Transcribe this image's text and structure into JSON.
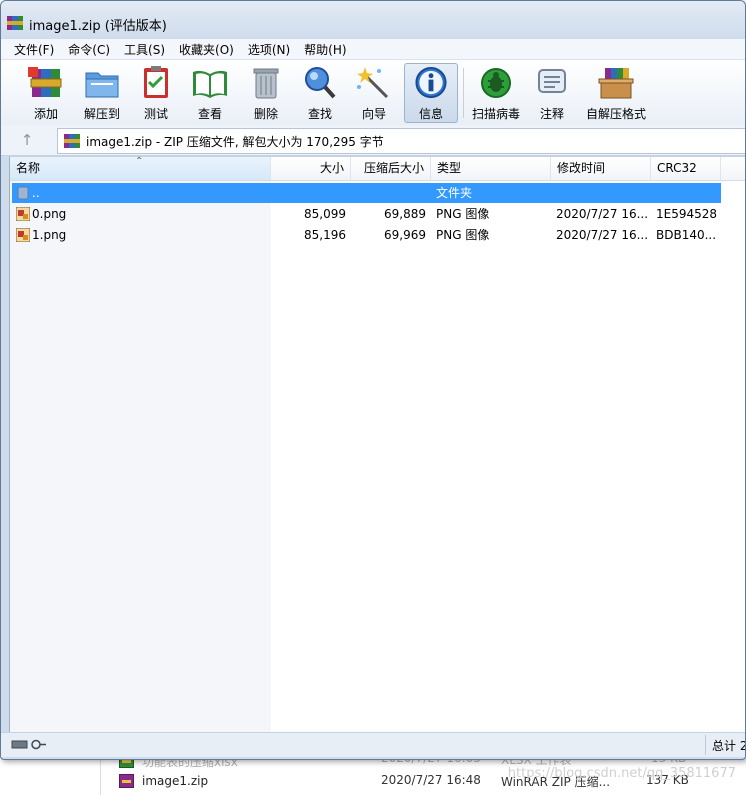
{
  "window": {
    "title": "image1.zip (评估版本)"
  },
  "menu": [
    {
      "label": "文件(F)"
    },
    {
      "label": "命令(C)"
    },
    {
      "label": "工具(S)"
    },
    {
      "label": "收藏夹(O)"
    },
    {
      "label": "选项(N)"
    },
    {
      "label": "帮助(H)"
    }
  ],
  "toolbar": {
    "add": "添加",
    "extract": "解压到",
    "test": "测试",
    "view": "查看",
    "delete": "删除",
    "find": "查找",
    "wizard": "向导",
    "info": "信息",
    "scan": "扫描病毒",
    "comment": "注释",
    "sfx": "自解压格式"
  },
  "address": {
    "up_icon": "up-arrow-icon",
    "text": "image1.zip - ZIP 压缩文件, 解包大小为 170,295 字节"
  },
  "columns": {
    "name": "名称",
    "size": "大小",
    "packed": "压缩后大小",
    "type": "类型",
    "modified": "修改时间",
    "crc": "CRC32"
  },
  "rows": [
    {
      "name": "..",
      "size": "",
      "packed": "",
      "type": "文件夹",
      "modified": "",
      "crc": ""
    },
    {
      "name": "0.png",
      "size": "85,099",
      "packed": "69,889",
      "type": "PNG 图像",
      "modified": "2020/7/27 16...",
      "crc": "1E594528"
    },
    {
      "name": "1.png",
      "size": "85,196",
      "packed": "69,969",
      "type": "PNG 图像",
      "modified": "2020/7/27 16...",
      "crc": "BDB140..."
    }
  ],
  "status": {
    "total": "总计 2"
  },
  "background": {
    "row_partial_name": "功能表的压缩xlsx",
    "row_partial_date": "2020/7/27 16:03",
    "row_partial_type": "XLSX 工作表",
    "row_partial_size": "13 KB",
    "file_name": "image1.zip",
    "file_date": "2020/7/27 16:48",
    "file_type": "WinRAR ZIP 压缩...",
    "file_size": "137 KB",
    "watermark": "https://blog.csdn.net/qq_35811677"
  },
  "colors": {
    "selection": "#3399ff",
    "window_frame": "#cfdcec",
    "info_button_active": "#cbd9ea"
  }
}
